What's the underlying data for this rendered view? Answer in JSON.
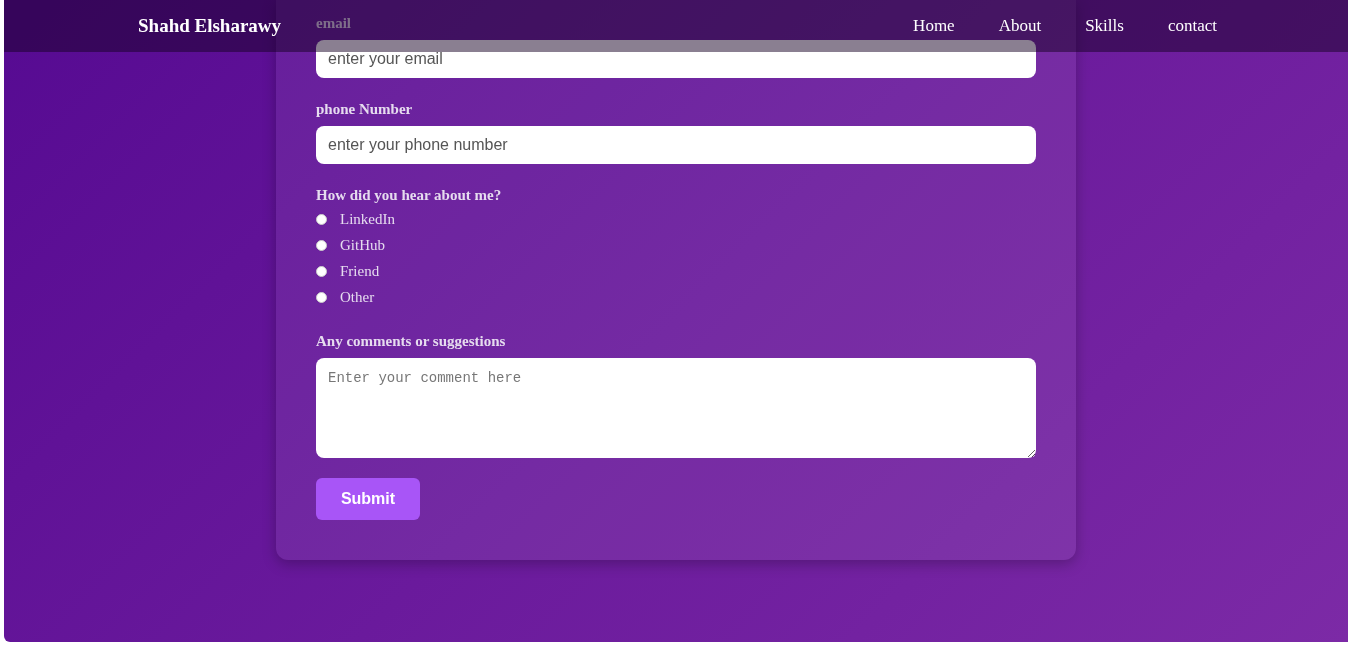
{
  "nav": {
    "logo": "Shahd Elsharawy",
    "links": [
      "Home",
      "About",
      "Skills",
      "contact"
    ]
  },
  "form": {
    "fields": [
      {
        "label": "email",
        "placeholder": "enter your email"
      },
      {
        "label": "phone Number",
        "placeholder": "enter your phone number"
      }
    ],
    "question": "How did you hear about me?",
    "options": [
      {
        "label": "LinkedIn",
        "selected": false
      },
      {
        "label": "GitHub",
        "selected": false
      },
      {
        "label": "Friend",
        "selected": false
      },
      {
        "label": "Other",
        "selected": false
      }
    ],
    "comments": {
      "label": "Any comments or suggestions",
      "placeholder": "Enter your comment here"
    },
    "submit": "Submit"
  }
}
